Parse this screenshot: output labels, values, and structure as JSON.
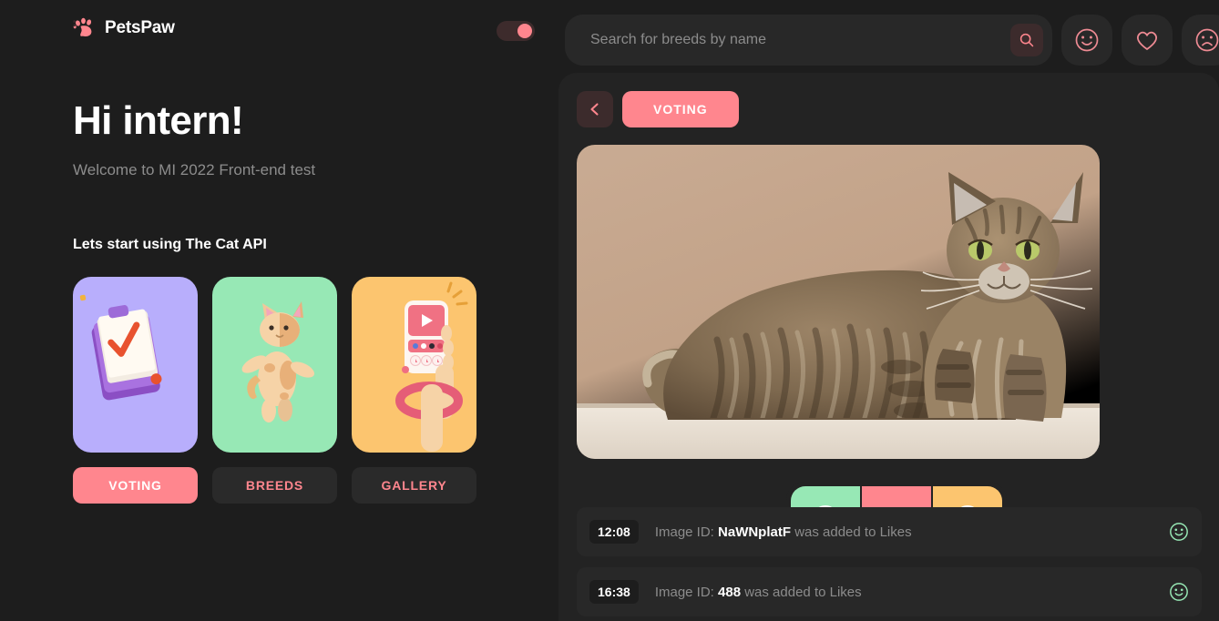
{
  "brand": {
    "name": "PetsPaw",
    "logo_icon": "paw-icon",
    "accent": "#ff868e"
  },
  "header": {
    "theme_toggle": {
      "icon": "toggle-switch",
      "state": "on"
    },
    "search": {
      "placeholder": "Search for breeds by name",
      "value": "",
      "button_icon": "search-icon"
    },
    "actions": [
      {
        "icon": "smile-icon",
        "name": "likes-button"
      },
      {
        "icon": "heart-icon",
        "name": "favourites-button"
      },
      {
        "icon": "frown-icon",
        "name": "dislikes-button"
      }
    ]
  },
  "hero": {
    "title": "Hi intern!",
    "subtitle": "Welcome to MI 2022 Front-end test",
    "section_title": "Lets start using The Cat API"
  },
  "cards": [
    {
      "label": "VOTING",
      "active": true,
      "thumb_color": "#b8aefc",
      "thumb_icon": "clipboard-check-illustration"
    },
    {
      "label": "BREEDS",
      "active": false,
      "thumb_color": "#97e8b5",
      "thumb_icon": "cat-illustration"
    },
    {
      "label": "GALLERY",
      "active": false,
      "thumb_color": "#fcc56f",
      "thumb_icon": "phone-in-hand-illustration"
    }
  ],
  "panel": {
    "back_icon": "chevron-left-icon",
    "page_label": "VOTING",
    "photo": {
      "name": "cat-photo",
      "background": "#c4a58d",
      "floor": "#e7ded3",
      "subject": "tabby-cat"
    },
    "vote_buttons": [
      {
        "icon": "smile-icon",
        "name": "vote-like-button",
        "color": "#97e8b5"
      },
      {
        "icon": "heart-icon",
        "name": "vote-favourite-button",
        "color": "#ff868e"
      },
      {
        "icon": "frown-icon",
        "name": "vote-dislike-button",
        "color": "#fcc56f"
      }
    ],
    "log": [
      {
        "time": "12:08",
        "prefix": "Image ID:",
        "image_id": "NaWNplatF",
        "suffix": "was added to Likes",
        "icon": "smile-icon",
        "icon_color": "#97e8b5"
      },
      {
        "time": "16:38",
        "prefix": "Image ID:",
        "image_id": "488",
        "suffix": "was added to Likes",
        "icon": "smile-icon",
        "icon_color": "#97e8b5"
      }
    ]
  }
}
